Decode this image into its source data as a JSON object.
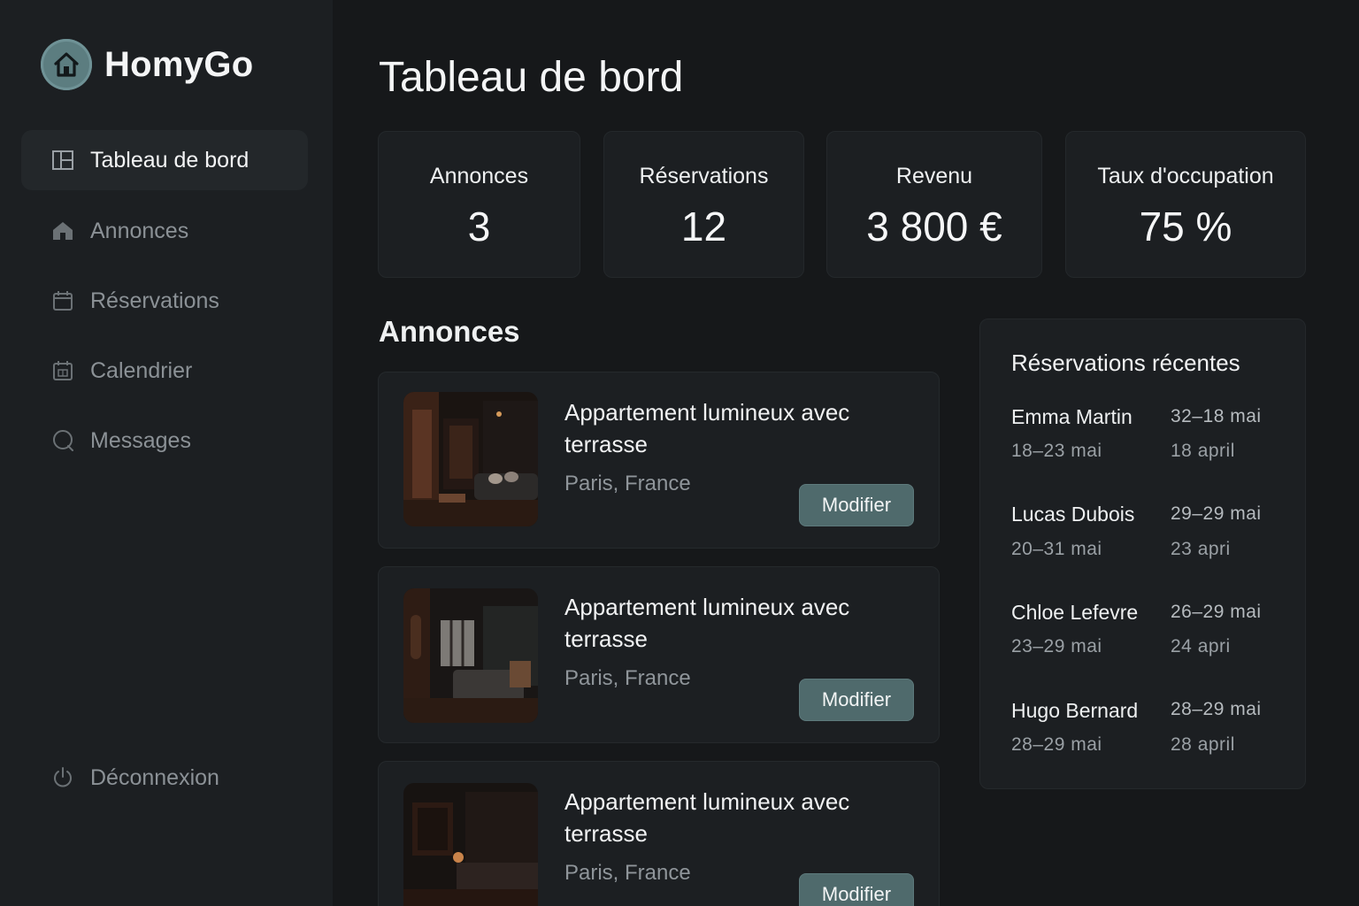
{
  "brand": {
    "name": "HomyGo",
    "logo_icon": "house-icon"
  },
  "sidebar": {
    "items": [
      {
        "label": "Tableau de bord",
        "icon": "dashboard-icon",
        "active": true
      },
      {
        "label": "Annonces",
        "icon": "house-icon",
        "active": false
      },
      {
        "label": "Réservations",
        "icon": "calendar-icon",
        "active": false
      },
      {
        "label": "Calendrier",
        "icon": "calendar-grid-icon",
        "active": false
      },
      {
        "label": "Messages",
        "icon": "chat-icon",
        "active": false
      }
    ],
    "logout": {
      "label": "Déconnexion",
      "icon": "power-icon"
    }
  },
  "main": {
    "title": "Tableau de bord",
    "stats": [
      {
        "label": "Annonces",
        "value": "3"
      },
      {
        "label": "Réservations",
        "value": "12"
      },
      {
        "label": "Revenu",
        "value": "3 800 €"
      },
      {
        "label": "Taux d'occupation",
        "value": "75 %"
      }
    ],
    "listings_title": "Annonces",
    "listings": [
      {
        "title": "Appartement lumineux avec terrasse",
        "location": "Paris, France",
        "button": "Modifier"
      },
      {
        "title": "Appartement lumineux avec terrasse",
        "location": "Paris, France",
        "button": "Modifier"
      },
      {
        "title": "Appartement lumineux avec terrasse",
        "location": "Paris, France",
        "button": "Modifier"
      }
    ]
  },
  "recent": {
    "title": "Réservations récentes",
    "items": [
      {
        "name": "Emma Martin",
        "dates": "18–23 mai",
        "right_top": "32–18 mai",
        "right_bottom": "18 april"
      },
      {
        "name": "Lucas Dubois",
        "dates": "20–31 mai",
        "right_top": "29–29 mai",
        "right_bottom": "23 apri"
      },
      {
        "name": "Chloe Lefevre",
        "dates": "23–29 mai",
        "right_top": "26–29 mai",
        "right_bottom": "24 apri"
      },
      {
        "name": "Hugo Bernard",
        "dates": "28–29 mai",
        "right_top": "28–29 mai",
        "right_bottom": "28 april"
      }
    ]
  },
  "colors": {
    "background": "#16181a",
    "sidebar": "#1c1f22",
    "card": "#1c1f22",
    "accent": "#4f6a6c",
    "muted_text": "#8b9196"
  }
}
